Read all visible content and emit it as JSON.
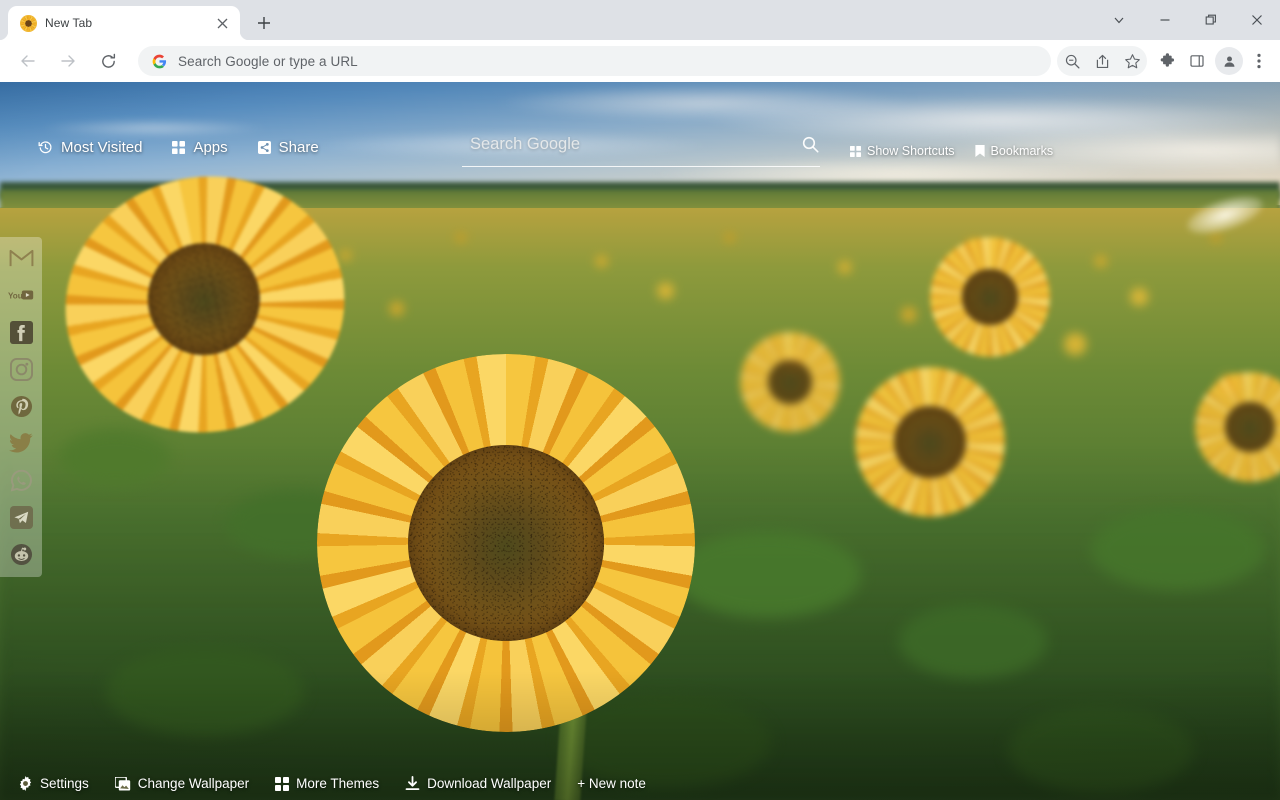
{
  "window": {
    "controls": [
      {
        "name": "tab-search",
        "icon": "chevron-down-icon"
      },
      {
        "name": "minimize",
        "icon": "minimize-icon"
      },
      {
        "name": "restore",
        "icon": "restore-icon"
      },
      {
        "name": "close",
        "icon": "close-icon"
      }
    ]
  },
  "tabstrip": {
    "tabs": [
      {
        "title": "New Tab",
        "favicon": "sunflower-favicon",
        "active": true
      }
    ],
    "close_label": "×",
    "new_tab_label": "+"
  },
  "toolbar": {
    "back": "back-arrow-icon",
    "forward": "forward-arrow-icon",
    "reload": "reload-icon",
    "omnibox": {
      "placeholder": "Search Google or type a URL",
      "value": "Search Google or type a URL",
      "leading_icon": "google-g-icon"
    },
    "actions": [
      {
        "name": "zoom-out-search-icon",
        "label": ""
      },
      {
        "name": "share-icon",
        "label": ""
      },
      {
        "name": "bookmark-star-icon",
        "label": ""
      },
      {
        "name": "extensions-puzzle-icon",
        "label": ""
      },
      {
        "name": "side-panel-icon",
        "label": ""
      },
      {
        "name": "profile-avatar-icon",
        "label": ""
      },
      {
        "name": "three-dot-menu-icon",
        "label": ""
      }
    ]
  },
  "newtab": {
    "top_links": [
      {
        "label": "Most Visited",
        "icon": "history-icon"
      },
      {
        "label": "Apps",
        "icon": "grid-icon"
      },
      {
        "label": "Share",
        "icon": "share-icon"
      }
    ],
    "search": {
      "placeholder": "Search Google",
      "value": "",
      "icon": "search-icon"
    },
    "right_links": [
      {
        "label": "Show Shortcuts",
        "icon": "grid-icon"
      },
      {
        "label": "Bookmarks",
        "icon": "bookmark-icon"
      }
    ],
    "social_sidebar": [
      {
        "name": "gmail",
        "label": "Gmail"
      },
      {
        "name": "youtube",
        "label": "YouTube"
      },
      {
        "name": "facebook",
        "label": "Facebook"
      },
      {
        "name": "instagram",
        "label": "Instagram"
      },
      {
        "name": "pinterest",
        "label": "Pinterest"
      },
      {
        "name": "twitter",
        "label": "Twitter"
      },
      {
        "name": "whatsapp",
        "label": "WhatsApp"
      },
      {
        "name": "telegram",
        "label": "Telegram"
      },
      {
        "name": "reddit",
        "label": "Reddit"
      }
    ],
    "bottom_bar": [
      {
        "label": "Settings",
        "icon": "gear-icon"
      },
      {
        "label": "Change Wallpaper",
        "icon": "images-icon"
      },
      {
        "label": "More Themes",
        "icon": "grid-icon"
      },
      {
        "label": "Download Wallpaper",
        "icon": "download-icon"
      },
      {
        "label": "+ New note",
        "icon": ""
      }
    ],
    "wallpaper_description": "Sunflower field at golden hour with large sunflower in foreground"
  },
  "colors": {
    "chrome_toolbar": "#ffffff",
    "tabstrip_bg": "#dee1e6",
    "omnibox_bg": "#f1f3f4",
    "text_primary": "#3c4043",
    "text_secondary": "#5f6368",
    "overlay_text": "#ffffff",
    "petal_yellow": "#f6c63f",
    "disc_brown": "#6d5119",
    "sky_blue": "#3f7fc0",
    "foliage_green": "#3b6626"
  }
}
